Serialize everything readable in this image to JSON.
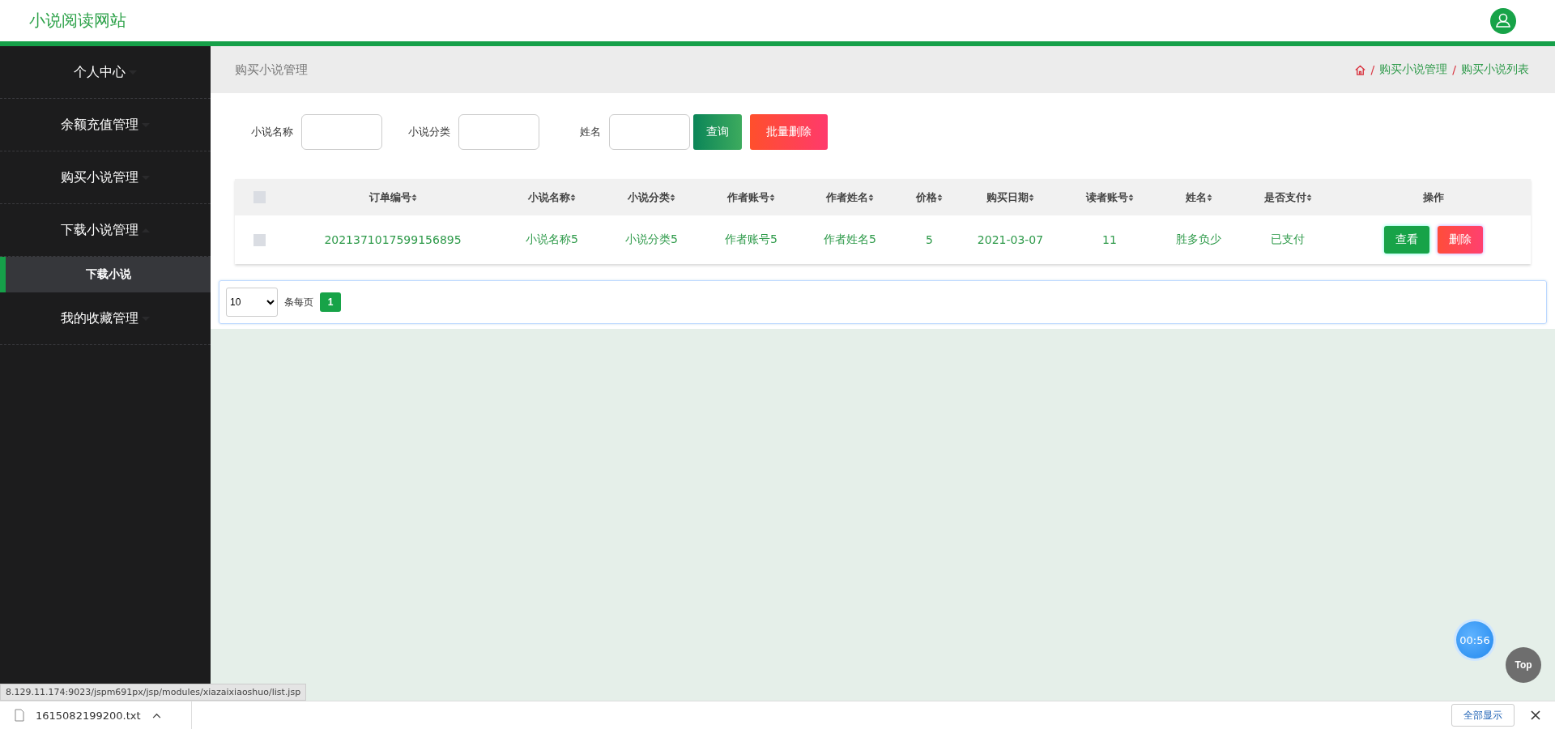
{
  "header": {
    "site_title": "小说阅读网站"
  },
  "sidebar": {
    "items": [
      {
        "label": "个人中心",
        "expanded": false
      },
      {
        "label": "余额充值管理",
        "expanded": false
      },
      {
        "label": "购买小说管理",
        "expanded": false
      },
      {
        "label": "下载小说管理",
        "expanded": true,
        "children": [
          {
            "label": "下载小说",
            "selected": true
          }
        ]
      },
      {
        "label": "我的收藏管理",
        "expanded": false
      }
    ]
  },
  "breadcrumb_bar": {
    "title": "购买小说管理",
    "separator": "/",
    "crumbs": [
      "购买小说管理",
      "购买小说列表"
    ]
  },
  "search": {
    "fields": [
      {
        "label": "小说名称"
      },
      {
        "label": "小说分类"
      },
      {
        "label": "姓名"
      }
    ],
    "buttons": [
      {
        "label": "查询",
        "kind": "query"
      },
      {
        "label": "批量删除",
        "kind": "danger"
      }
    ]
  },
  "table": {
    "all_checked": false,
    "columns": [
      "订单编号",
      "小说名称",
      "小说分类",
      "作者账号",
      "作者姓名",
      "价格",
      "购买日期",
      "读者账号",
      "姓名",
      "是否支付"
    ],
    "action_column": "操作",
    "rows": [
      {
        "checked": false,
        "cells": [
          "2021371017599156895",
          "小说名称5",
          "小说分类5",
          "作者账号5",
          "作者姓名5",
          "5",
          "2021-03-07",
          "11",
          "胜多负少",
          "已支付"
        ],
        "actions": [
          {
            "label": "查看",
            "kind": "view"
          },
          {
            "label": "删除",
            "kind": "delete"
          }
        ]
      }
    ]
  },
  "pagination": {
    "page_size": "10",
    "per_page_label": "条每页",
    "pages": [
      {
        "label": "1",
        "selected": true
      }
    ]
  },
  "timer": "00:56",
  "top_button": "Top",
  "status_url": "8.129.11.174:9023/jspm691px/jsp/modules/xiazaixiaoshuo/list.jsp",
  "download_bar": {
    "file": "1615082199200.txt",
    "show_all": "全部显示"
  }
}
